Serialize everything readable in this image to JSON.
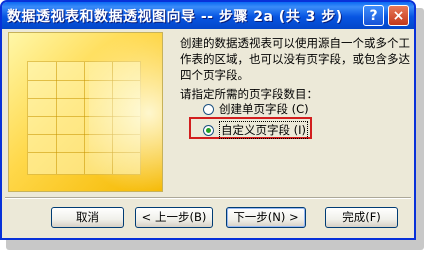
{
  "window": {
    "title": "数据透视表和数据透视图向导 -- 步骤 2a (共 3 步)"
  },
  "titlebar": {
    "help_label": "?",
    "close_label": "×"
  },
  "description": "创建的数据透视表可以使用源自一个或多个工作表的区域，也可以没有页字段，或包含多达四个页字段。",
  "prompt": "请指定所需的页字段数目：",
  "options": [
    {
      "label": "创建单页字段 (C)",
      "selected": false
    },
    {
      "label": "自定义页字段 (I)",
      "selected": true
    }
  ],
  "buttons": {
    "cancel": "取消",
    "back": "< 上一步(B)",
    "next": "下一步(N) >",
    "finish": "完成(F)"
  },
  "colors": {
    "title_bar": "#0755E2",
    "highlight_box": "#D21E1E",
    "dialog_bg": "#ECE9D8"
  }
}
